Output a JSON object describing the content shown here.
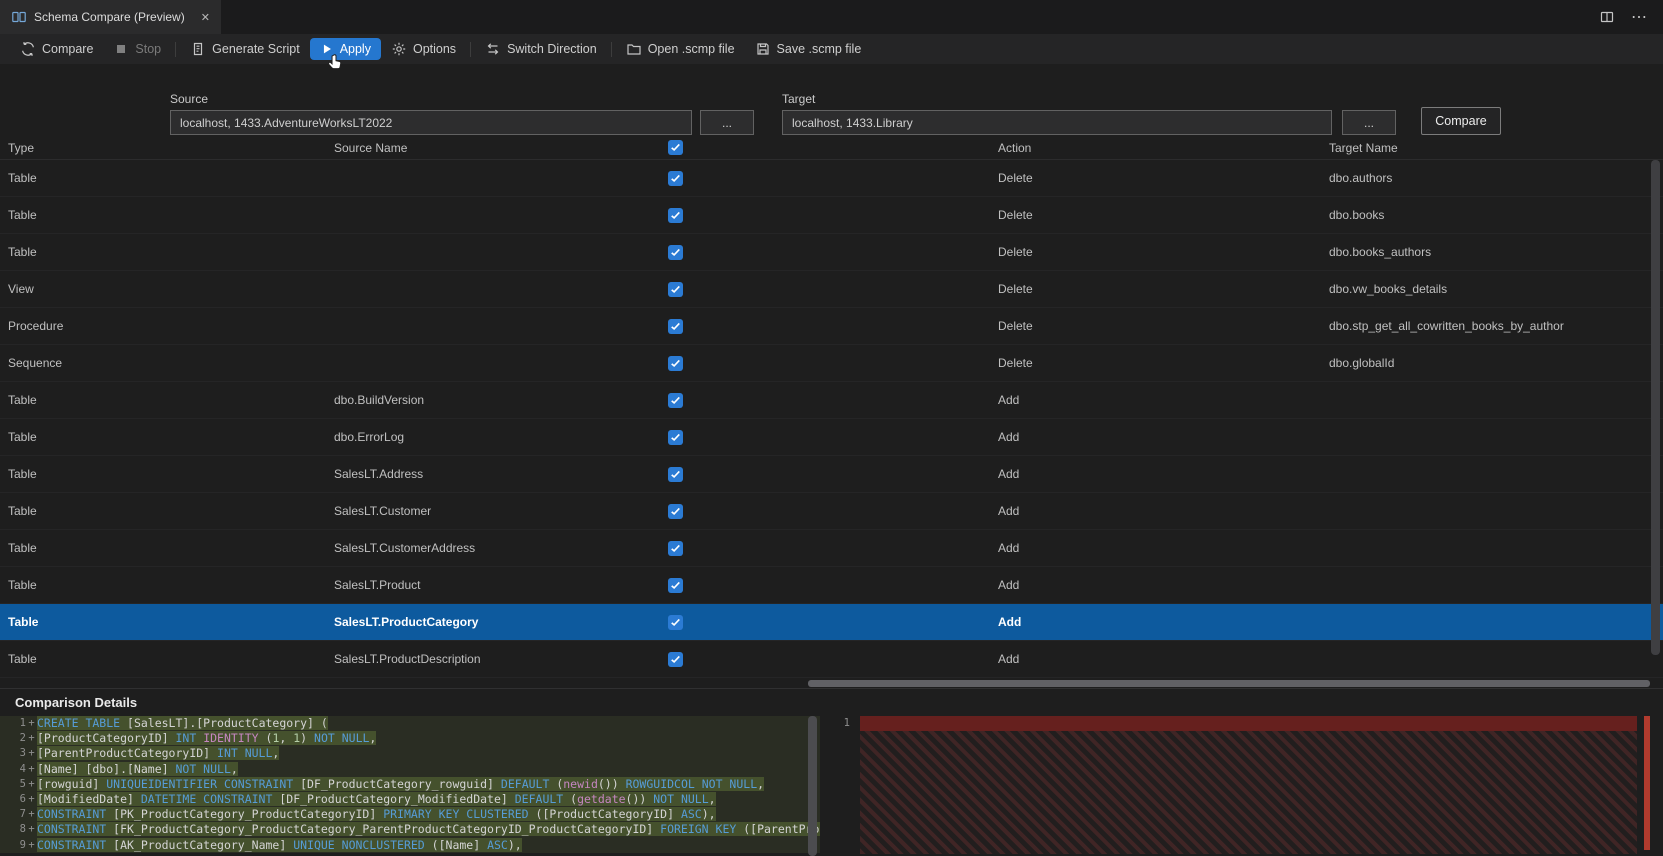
{
  "window": {
    "tab_title": "Schema Compare (Preview)",
    "close_glyph": "✕",
    "more_glyph": "⋯"
  },
  "toolbar": {
    "compare": "Compare",
    "stop": "Stop",
    "generate_script": "Generate Script",
    "apply": "Apply",
    "options": "Options",
    "switch_direction": "Switch Direction",
    "open_scmp": "Open .scmp file",
    "save_scmp": "Save .scmp file"
  },
  "connections": {
    "source_label": "Source",
    "source_value": "localhost, 1433.AdventureWorksLT2022",
    "target_label": "Target",
    "target_value": "localhost, 1433.Library",
    "browse": "...",
    "compare_button": "Compare"
  },
  "grid": {
    "headers": {
      "type": "Type",
      "source_name": "Source Name",
      "action": "Action",
      "target_name": "Target Name"
    },
    "header_checkbox_checked": true,
    "rows": [
      {
        "type": "Table",
        "source": "",
        "checked": true,
        "action": "Delete",
        "target": "dbo.authors",
        "selected": false
      },
      {
        "type": "Table",
        "source": "",
        "checked": true,
        "action": "Delete",
        "target": "dbo.books",
        "selected": false
      },
      {
        "type": "Table",
        "source": "",
        "checked": true,
        "action": "Delete",
        "target": "dbo.books_authors",
        "selected": false
      },
      {
        "type": "View",
        "source": "",
        "checked": true,
        "action": "Delete",
        "target": "dbo.vw_books_details",
        "selected": false
      },
      {
        "type": "Procedure",
        "source": "",
        "checked": true,
        "action": "Delete",
        "target": "dbo.stp_get_all_cowritten_books_by_author",
        "selected": false
      },
      {
        "type": "Sequence",
        "source": "",
        "checked": true,
        "action": "Delete",
        "target": "dbo.globalId",
        "selected": false
      },
      {
        "type": "Table",
        "source": "dbo.BuildVersion",
        "checked": true,
        "action": "Add",
        "target": "",
        "selected": false
      },
      {
        "type": "Table",
        "source": "dbo.ErrorLog",
        "checked": true,
        "action": "Add",
        "target": "",
        "selected": false
      },
      {
        "type": "Table",
        "source": "SalesLT.Address",
        "checked": true,
        "action": "Add",
        "target": "",
        "selected": false
      },
      {
        "type": "Table",
        "source": "SalesLT.Customer",
        "checked": true,
        "action": "Add",
        "target": "",
        "selected": false
      },
      {
        "type": "Table",
        "source": "SalesLT.CustomerAddress",
        "checked": true,
        "action": "Add",
        "target": "",
        "selected": false
      },
      {
        "type": "Table",
        "source": "SalesLT.Product",
        "checked": true,
        "action": "Add",
        "target": "",
        "selected": false
      },
      {
        "type": "Table",
        "source": "SalesLT.ProductCategory",
        "checked": true,
        "action": "Add",
        "target": "",
        "selected": true
      },
      {
        "type": "Table",
        "source": "SalesLT.ProductDescription",
        "checked": true,
        "action": "Add",
        "target": "",
        "selected": false
      }
    ]
  },
  "details": {
    "title": "Comparison Details",
    "left": {
      "lines": [
        {
          "num": "1",
          "marker": "+",
          "segments": [
            [
              "k",
              "CREATE TABLE "
            ],
            [
              "i",
              "[SalesLT].[ProductCategory] ("
            ]
          ]
        },
        {
          "num": "2",
          "marker": "+",
          "segments": [
            [
              "i",
              "[ProductCategoryID] "
            ],
            [
              "k",
              "INT "
            ],
            [
              "f",
              "IDENTITY "
            ],
            [
              "i",
              "("
            ],
            [
              "n",
              "1"
            ],
            [
              "i",
              ", "
            ],
            [
              "n",
              "1"
            ],
            [
              "i",
              ") "
            ],
            [
              "k",
              "NOT NULL"
            ],
            [
              "i",
              ","
            ]
          ]
        },
        {
          "num": "3",
          "marker": "+",
          "segments": [
            [
              "i",
              "[ParentProductCategoryID] "
            ],
            [
              "k",
              "INT NULL"
            ],
            [
              "i",
              ","
            ]
          ]
        },
        {
          "num": "4",
          "marker": "+",
          "segments": [
            [
              "i",
              "[Name] [dbo].[Name] "
            ],
            [
              "k",
              "NOT NULL"
            ],
            [
              "i",
              ","
            ]
          ]
        },
        {
          "num": "5",
          "marker": "+",
          "segments": [
            [
              "i",
              "[rowguid] "
            ],
            [
              "k",
              "UNIQUEIDENTIFIER CONSTRAINT "
            ],
            [
              "i",
              "[DF_ProductCategory_rowguid] "
            ],
            [
              "k",
              "DEFAULT "
            ],
            [
              "i",
              "("
            ],
            [
              "f",
              "newid"
            ],
            [
              "i",
              "()) "
            ],
            [
              "k",
              "ROWGUIDCOL NOT NULL"
            ],
            [
              "i",
              ","
            ]
          ]
        },
        {
          "num": "6",
          "marker": "+",
          "segments": [
            [
              "i",
              "[ModifiedDate] "
            ],
            [
              "k",
              "DATETIME CONSTRAINT "
            ],
            [
              "i",
              "[DF_ProductCategory_ModifiedDate] "
            ],
            [
              "k",
              "DEFAULT "
            ],
            [
              "i",
              "("
            ],
            [
              "f",
              "getdate"
            ],
            [
              "i",
              "()) "
            ],
            [
              "k",
              "NOT NULL"
            ],
            [
              "i",
              ","
            ]
          ]
        },
        {
          "num": "7",
          "marker": "+",
          "segments": [
            [
              "k",
              "CONSTRAINT "
            ],
            [
              "i",
              "[PK_ProductCategory_ProductCategoryID] "
            ],
            [
              "k",
              "PRIMARY KEY CLUSTERED "
            ],
            [
              "i",
              "([ProductCategoryID] "
            ],
            [
              "k",
              "ASC"
            ],
            [
              "i",
              "),"
            ]
          ]
        },
        {
          "num": "8",
          "marker": "+",
          "segments": [
            [
              "k",
              "CONSTRAINT "
            ],
            [
              "i",
              "[FK_ProductCategory_ProductCategory_ParentProductCategoryID_ProductCategoryID] "
            ],
            [
              "k",
              "FOREIGN KEY "
            ],
            [
              "i",
              "([ParentProductCatego"
            ]
          ]
        },
        {
          "num": "9",
          "marker": "+",
          "segments": [
            [
              "k",
              "CONSTRAINT "
            ],
            [
              "i",
              "[AK_ProductCategory_Name] "
            ],
            [
              "k",
              "UNIQUE NONCLUSTERED "
            ],
            [
              "i",
              "([Name] "
            ],
            [
              "k",
              "ASC"
            ],
            [
              "i",
              "),"
            ]
          ]
        }
      ]
    },
    "right": {
      "lines": [
        {
          "num": "1"
        }
      ]
    }
  },
  "colors": {
    "accent_blue": "#2577cf",
    "checkbox_blue": "#2b7bd4",
    "selected_row_blue": "#0d5a9e",
    "added_line_green": "#9bb955",
    "removed_line_red": "#66201e",
    "overview_ruler_red": "#b23b2e"
  }
}
